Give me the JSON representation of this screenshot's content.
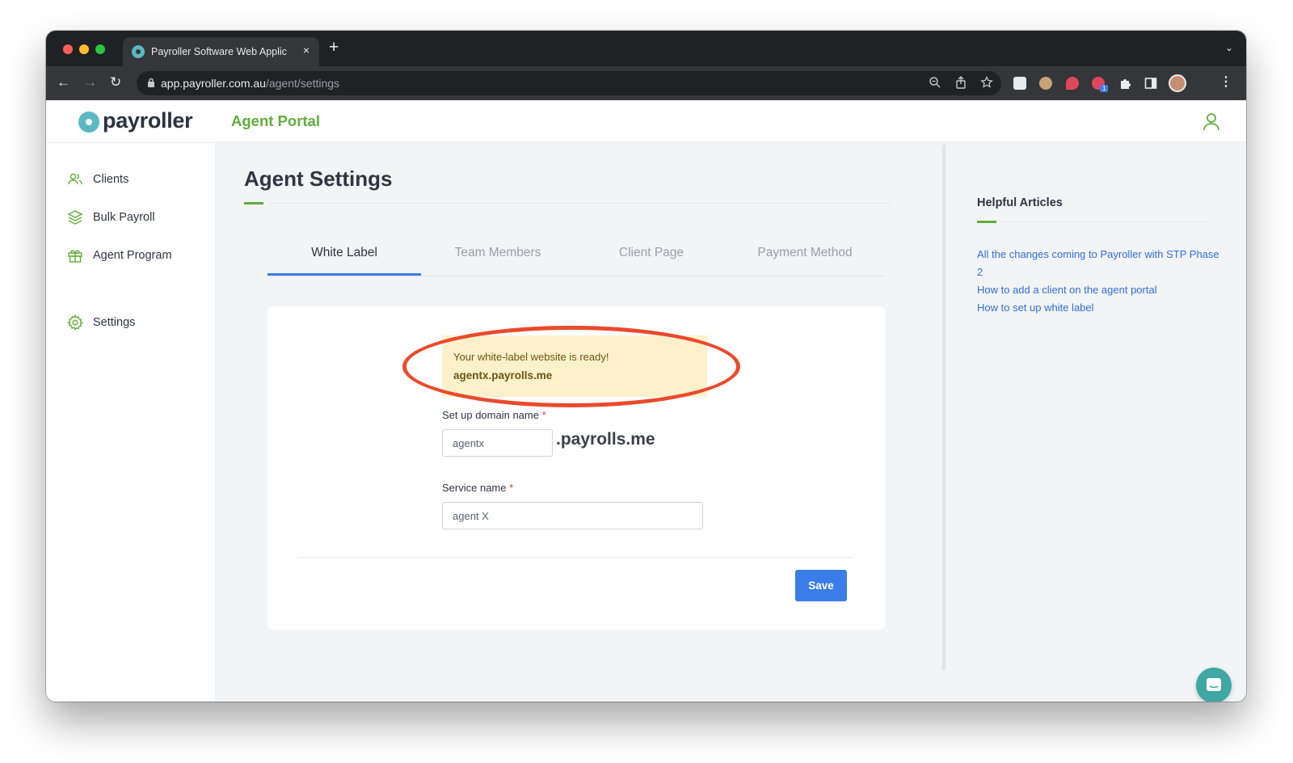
{
  "browser": {
    "tab_title": "Payroller Software Web Applic",
    "tab_close": "×",
    "new_tab": "+",
    "tab_menu": "⌄",
    "url_host": "app.payroller.com.au",
    "url_path": "/agent/settings",
    "extension_badge": "1"
  },
  "app": {
    "logo_text": "payroller",
    "portal_title": "Agent Portal",
    "brand_color": "#5fae3b",
    "accent_color": "#3b7de8"
  },
  "sidebar": {
    "items": [
      {
        "label": "Clients",
        "icon": "users-icon"
      },
      {
        "label": "Bulk Payroll",
        "icon": "layers-icon"
      },
      {
        "label": "Agent Program",
        "icon": "gift-icon"
      },
      {
        "label": "Settings",
        "icon": "gear-icon"
      }
    ]
  },
  "main": {
    "title": "Agent Settings",
    "tabs": [
      {
        "label": "White Label",
        "active": true
      },
      {
        "label": "Team Members",
        "active": false
      },
      {
        "label": "Client Page",
        "active": false
      },
      {
        "label": "Payment Method",
        "active": false
      }
    ],
    "notice": {
      "message": "Your white-label website is ready!",
      "domain": "agentx.payrolls.me"
    },
    "domain_field": {
      "label": "Set up domain name",
      "required_mark": "*",
      "value": "agentx",
      "suffix": ".payrolls.me"
    },
    "service_field": {
      "label": "Service name",
      "required_mark": "*",
      "value": "agent X"
    },
    "save_label": "Save"
  },
  "help": {
    "title": "Helpful Articles",
    "links": [
      "All the changes coming to Payroller with STP Phase 2",
      "How to add a client on the agent portal",
      "How to set up white label"
    ]
  }
}
